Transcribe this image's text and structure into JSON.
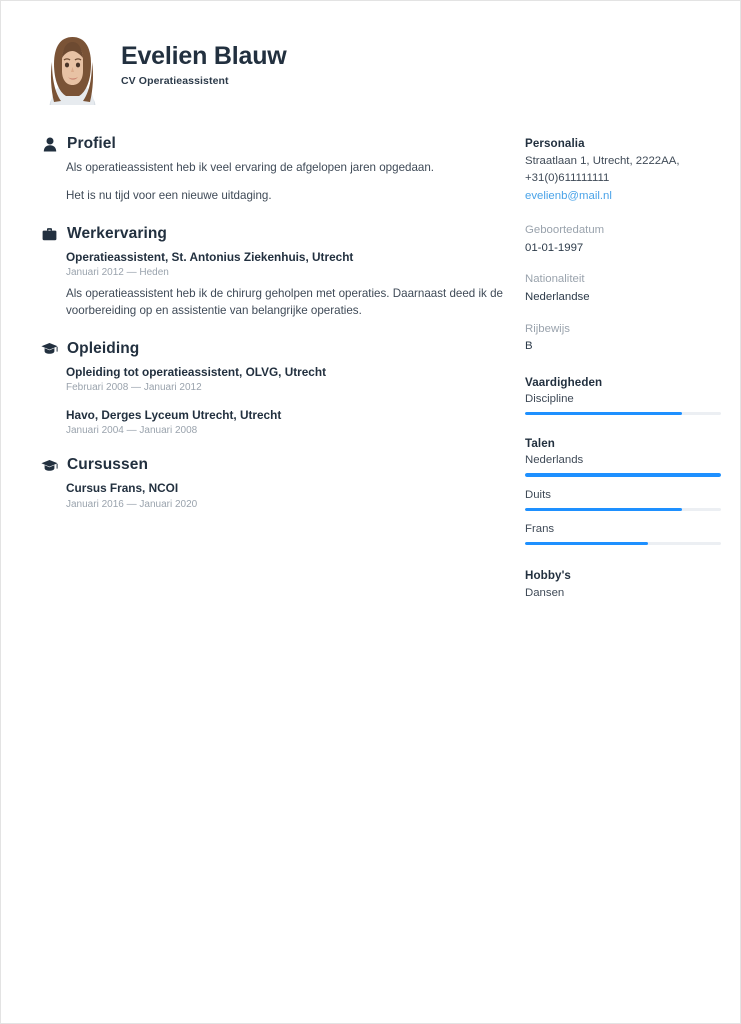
{
  "header": {
    "full_name": "Evelien Blauw",
    "job_title": "CV Operatieassistent",
    "photo_alt": "portrait-photo"
  },
  "colors": {
    "accent": "#1e90ff",
    "heading": "#22303f",
    "body_text": "#3f4a57",
    "muted": "#9aa3ad",
    "link": "#4aa3e8",
    "bar_track": "#eceff3"
  },
  "main_sections": [
    {
      "icon": "person-icon",
      "title": "Profiel",
      "paragraphs": [
        "Als operatieassistent heb ik veel ervaring de afgelopen jaren opgedaan.",
        "Het is nu tijd voor een nieuwe uitdaging."
      ]
    },
    {
      "icon": "briefcase-icon",
      "title": "Werkervaring",
      "entries": [
        {
          "title": "Operatieassistent, St. Antonius Ziekenhuis, Utrecht",
          "dates": "Januari 2012 — Heden",
          "description": "Als operatieassistent heb ik de chirurg geholpen met operaties. Daarnaast deed ik de voorbereiding op en assistentie van belangrijke operaties."
        }
      ]
    },
    {
      "icon": "graduation-cap-icon",
      "title": "Opleiding",
      "entries": [
        {
          "title": "Opleiding tot operatieassistent, OLVG, Utrecht",
          "dates": "Februari 2008 — Januari 2012",
          "description": ""
        },
        {
          "title": "Havo, Derges Lyceum Utrecht, Utrecht",
          "dates": "Januari 2004 — Januari 2008",
          "description": ""
        }
      ]
    },
    {
      "icon": "graduation-cap-icon",
      "title": "Cursussen",
      "entries": [
        {
          "title": "Cursus Frans, NCOI",
          "dates": "Januari 2016 — Januari 2020",
          "description": ""
        }
      ]
    }
  ],
  "sidebar": {
    "personalia": {
      "title": "Personalia",
      "address": "Straatlaan 1, Utrecht, 2222AA,",
      "phone": "+31(0)611111111",
      "email": "evelienb@mail.nl"
    },
    "fields": [
      {
        "label": "Geboortedatum",
        "value": "01-01-1997"
      },
      {
        "label": "Nationaliteit",
        "value": "Nederlandse"
      },
      {
        "label": "Rijbewijs",
        "value": "B"
      }
    ],
    "skills": {
      "title": "Vaardigheden",
      "items": [
        {
          "name": "Discipline",
          "level": 80
        }
      ]
    },
    "languages": {
      "title": "Talen",
      "items": [
        {
          "name": "Nederlands",
          "level": 100
        },
        {
          "name": "Duits",
          "level": 80
        },
        {
          "name": "Frans",
          "level": 63
        }
      ]
    },
    "hobbies": {
      "title": "Hobby's",
      "value": "Dansen"
    }
  }
}
